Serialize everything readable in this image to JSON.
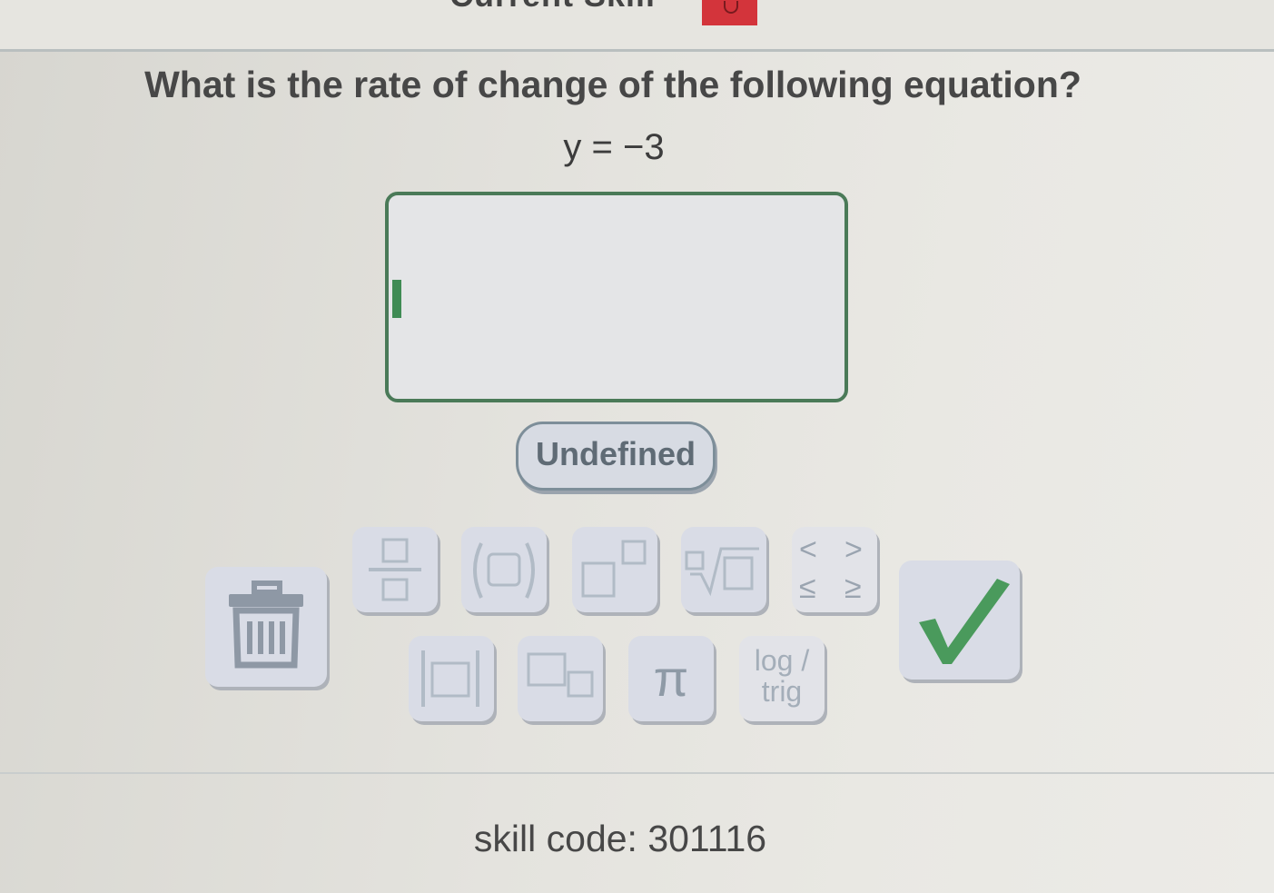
{
  "header": {
    "title": "Current Skill"
  },
  "question": {
    "prompt": "What is the rate of change of the following equation?",
    "equation": "y = −3"
  },
  "answer": {
    "value": ""
  },
  "choices": {
    "undefined_label": "Undefined"
  },
  "keypad": {
    "pi_label": "π",
    "log_line1": "log /",
    "log_line2": "trig",
    "ineq": {
      "lt": "<",
      "gt": ">",
      "le": "≤",
      "ge": "≥"
    }
  },
  "footer": {
    "skill_code": "skill code: 301116"
  },
  "colors": {
    "accent_green": "#4a9a5c",
    "header_badge": "#d3343b",
    "key_face": "#d9dce6"
  },
  "icons": [
    "trash-icon",
    "checkmark-icon",
    "fraction-icon",
    "parentheses-icon",
    "exponent-icon",
    "nth-root-icon",
    "absolute-value-icon",
    "subscript-icon"
  ]
}
